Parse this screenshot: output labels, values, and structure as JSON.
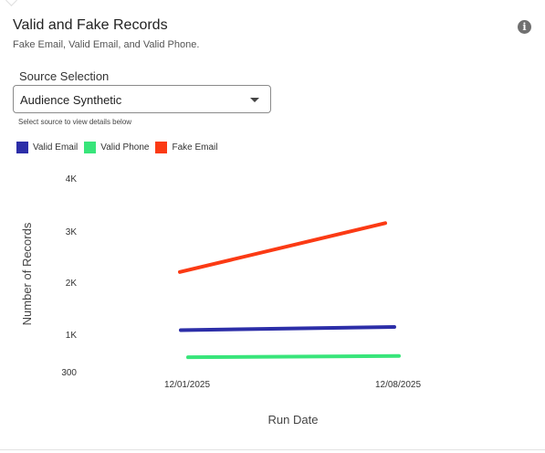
{
  "card": {
    "title": "Valid and Fake Records",
    "subtitle": "Fake Email, Valid Email, and Valid Phone.",
    "info_icon": "info-icon"
  },
  "source": {
    "label": "Source Selection",
    "selected": "Audience Synthetic",
    "helper": "Select source to view details below"
  },
  "chart_data": {
    "type": "line",
    "x": [
      "12/01/2025",
      "12/08/2025"
    ],
    "series": [
      {
        "name": "Valid Email",
        "color": "#2c2ea8",
        "values": [
          1080,
          1140
        ]
      },
      {
        "name": "Valid Phone",
        "color": "#38e57a",
        "values": [
          570,
          595
        ]
      },
      {
        "name": "Fake Email",
        "color": "#fb3a14",
        "values": [
          2200,
          3150
        ]
      }
    ],
    "xlabel": "Run Date",
    "ylabel": "Number of Records",
    "yticks": [
      {
        "value": 300,
        "label": "300"
      },
      {
        "value": 1000,
        "label": "1K"
      },
      {
        "value": 2000,
        "label": "2K"
      },
      {
        "value": 3000,
        "label": "3K"
      },
      {
        "value": 4000,
        "label": "4K"
      }
    ],
    "legend": "top-left",
    "grid": false
  }
}
